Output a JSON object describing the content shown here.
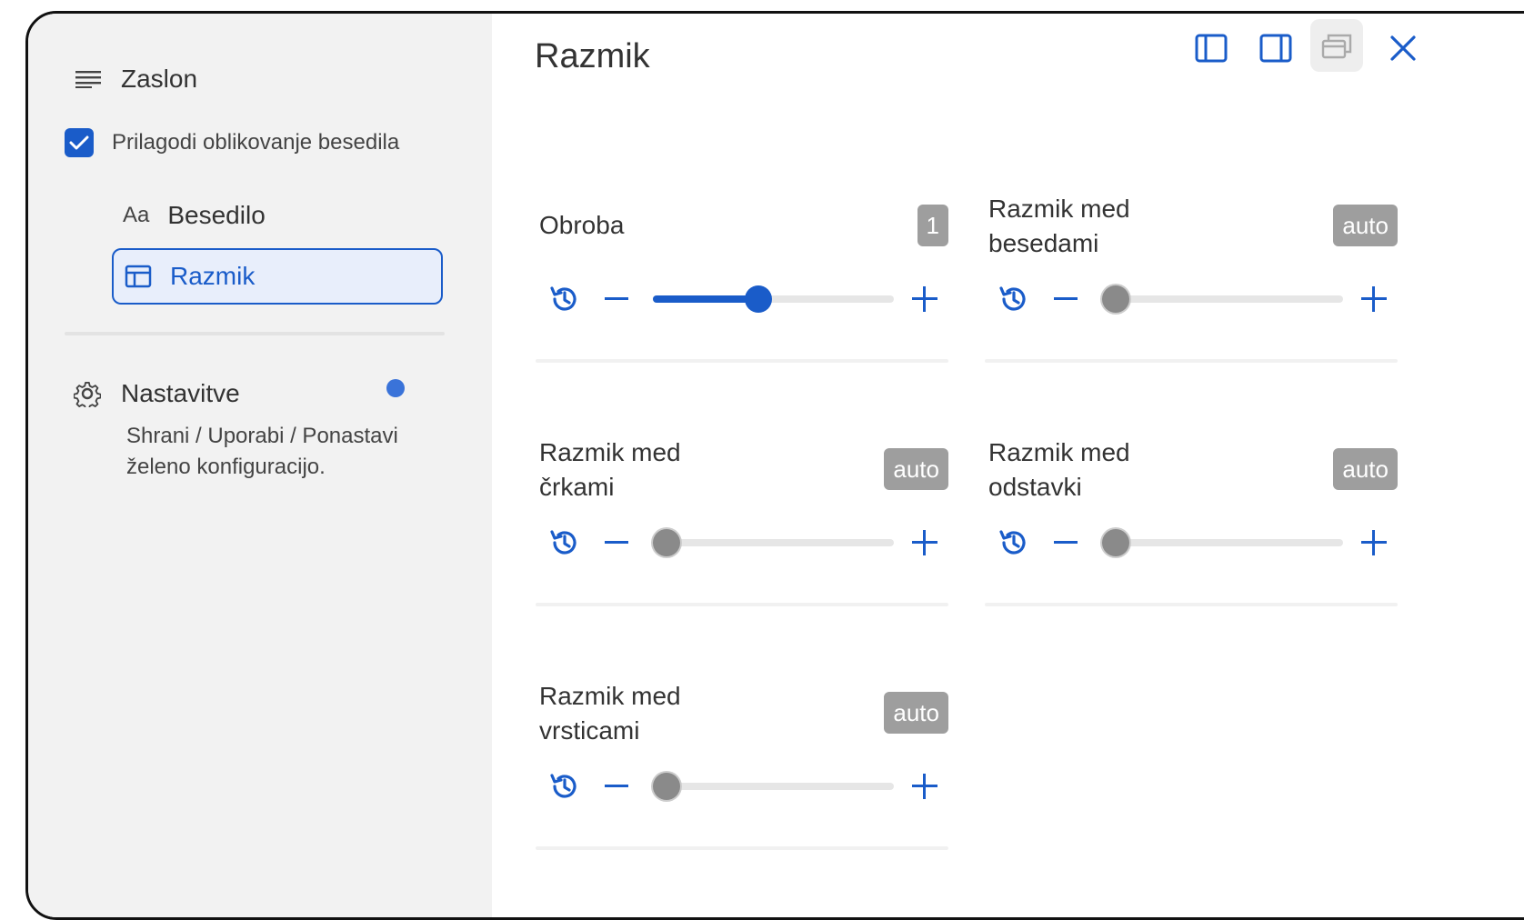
{
  "sidebar": {
    "display_label": "Zaslon",
    "customize_checkbox": {
      "label": "Prilagodi oblikovanje besedila",
      "checked": true
    },
    "nav": [
      {
        "icon": "text-size-icon",
        "icon_text": "Aa",
        "label": "Besedilo",
        "active": false
      },
      {
        "icon": "layout-icon",
        "label": "Razmik",
        "active": true
      }
    ],
    "settings": {
      "label": "Nastavitve",
      "description_line1": "Shrani / Uporabi / Ponastavi",
      "description_line2": "želeno konfiguracijo.",
      "indicator_color": "#3a73d9"
    }
  },
  "main": {
    "title": "Razmik",
    "window_controls": [
      "sidebar-left-icon",
      "sidebar-right-icon",
      "popout-icon",
      "close-icon"
    ],
    "settings": [
      {
        "label_line1": "Obroba",
        "label_line2": "",
        "value": "1",
        "slider_level": 0.43,
        "active": true
      },
      {
        "label_line1": "Razmik med",
        "label_line2": "besedami",
        "value": "auto",
        "slider_level": 0.0,
        "active": false
      },
      {
        "label_line1": "Razmik med",
        "label_line2": "črkami",
        "value": "auto",
        "slider_level": 0.0,
        "active": false
      },
      {
        "label_line1": "Razmik med",
        "label_line2": "odstavki",
        "value": "auto",
        "slider_level": 0.0,
        "active": false
      },
      {
        "label_line1": "Razmik med",
        "label_line2": "vrsticami",
        "value": "auto",
        "slider_level": 0.0,
        "active": false
      }
    ]
  },
  "colors": {
    "accent": "#1a5cc9",
    "badge": "#9e9e9e",
    "sidebar_bg": "#f2f2f2"
  }
}
